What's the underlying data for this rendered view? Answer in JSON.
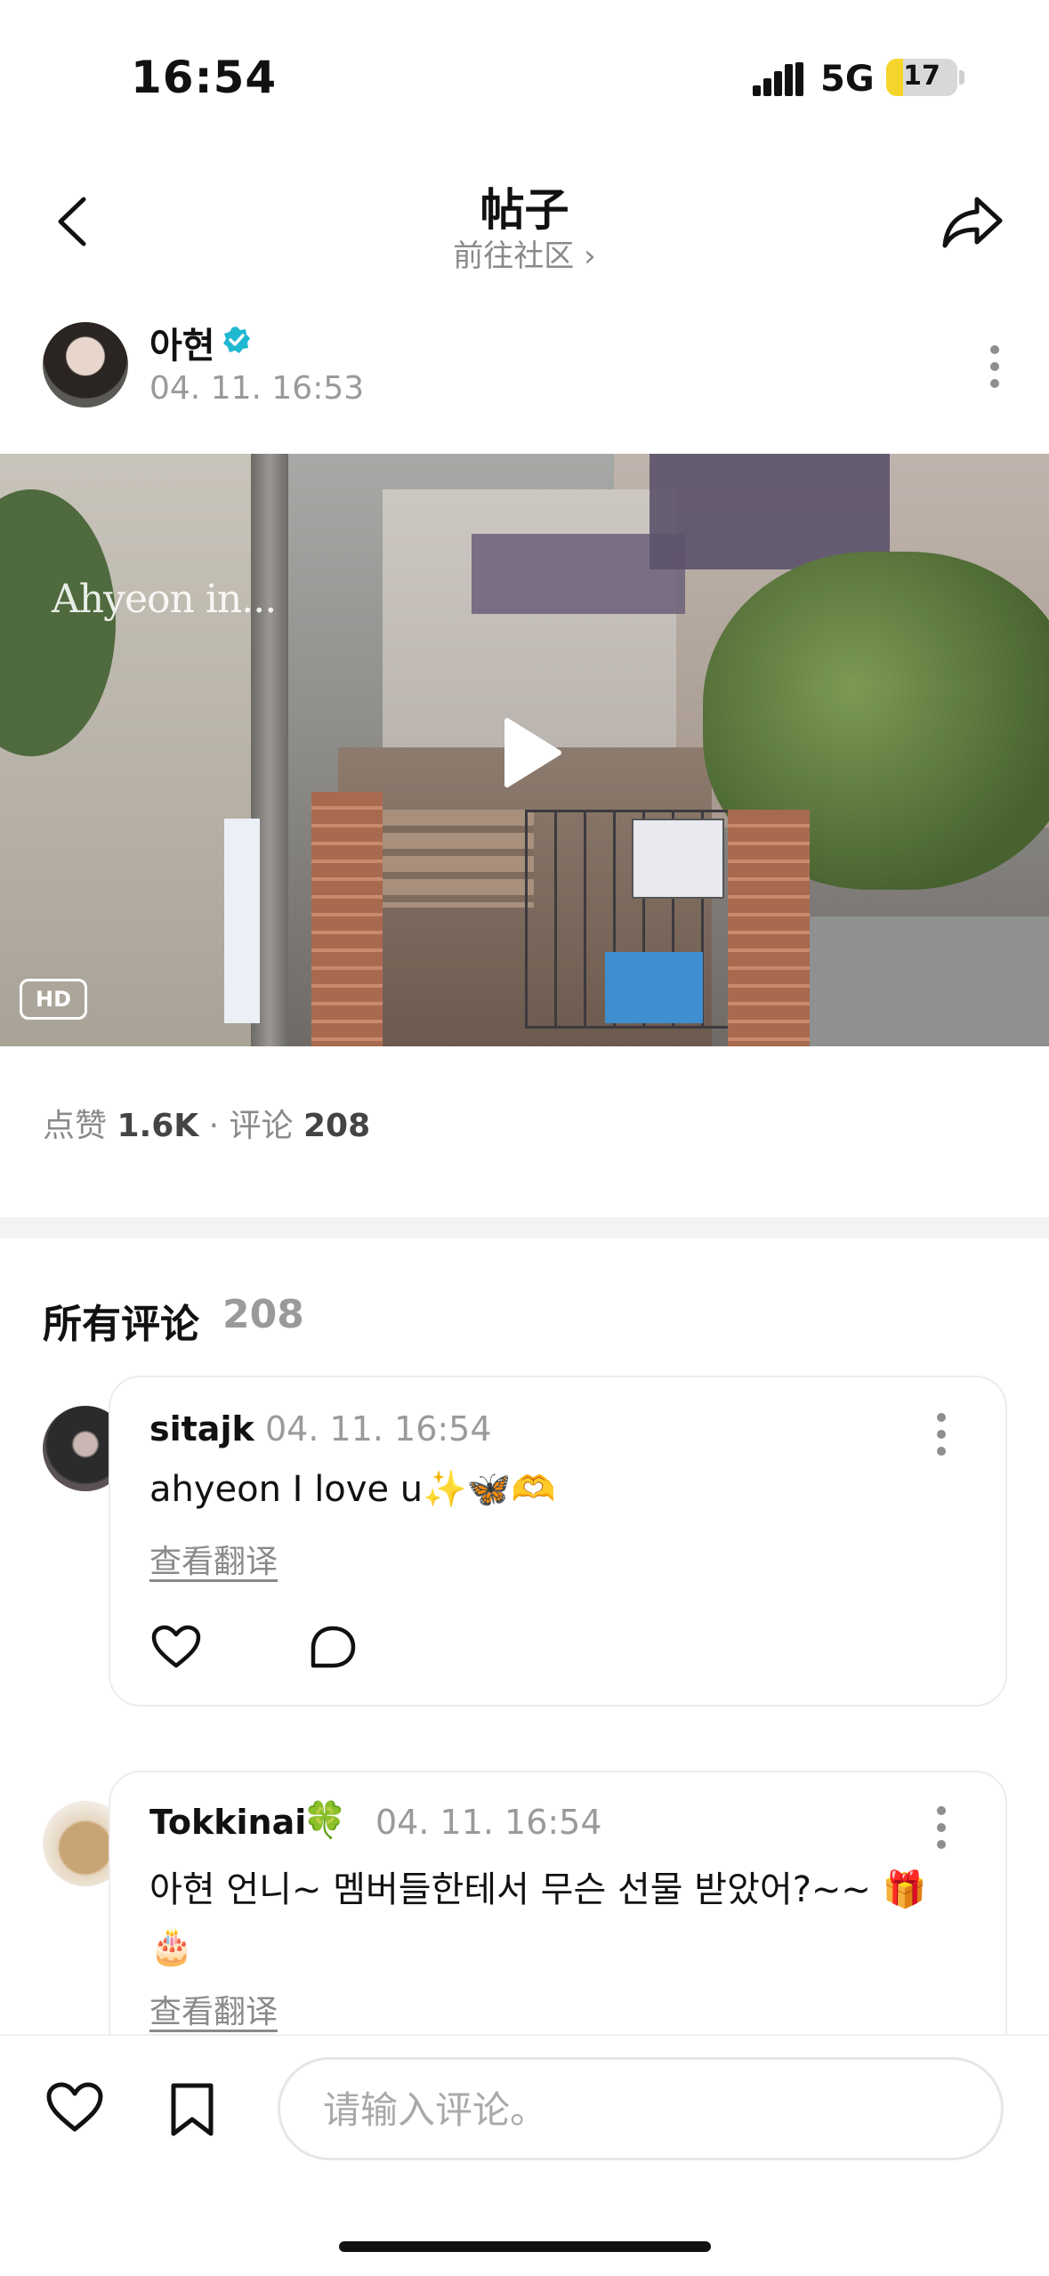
{
  "status_bar": {
    "time": "16:54",
    "network": "5G",
    "battery": "17",
    "battery_level": 0.17
  },
  "header": {
    "title": "帖子",
    "subtitle": "前往社区 ›"
  },
  "post": {
    "author": "아현",
    "time": "04. 11. 16:53",
    "video": {
      "watermark": "Ahyeon in...",
      "quality_badge": "HD"
    },
    "stats": {
      "likes_label": "点赞",
      "likes": "1.6K",
      "separator": "·",
      "comments_label": "评论",
      "comments": "208"
    }
  },
  "comments_section": {
    "title": "所有评论",
    "count": "208",
    "items": [
      {
        "user": "sitajk",
        "badge": "",
        "time": "04. 11. 16:54",
        "text": "ahyeon I love u✨🦋🫶",
        "translate": "查看翻译"
      },
      {
        "user": "Tokkinai",
        "badge": "🍀",
        "time": "04. 11. 16:54",
        "text": "아현 언니~ 멤버들한테서 무슨 선물 받았어?~~ 🎁🎂",
        "translate": "查看翻译"
      }
    ]
  },
  "composer": {
    "placeholder": "请输入评论。"
  },
  "colors": {
    "verified": "#1fb8d1",
    "battery": "#f5d52b"
  }
}
